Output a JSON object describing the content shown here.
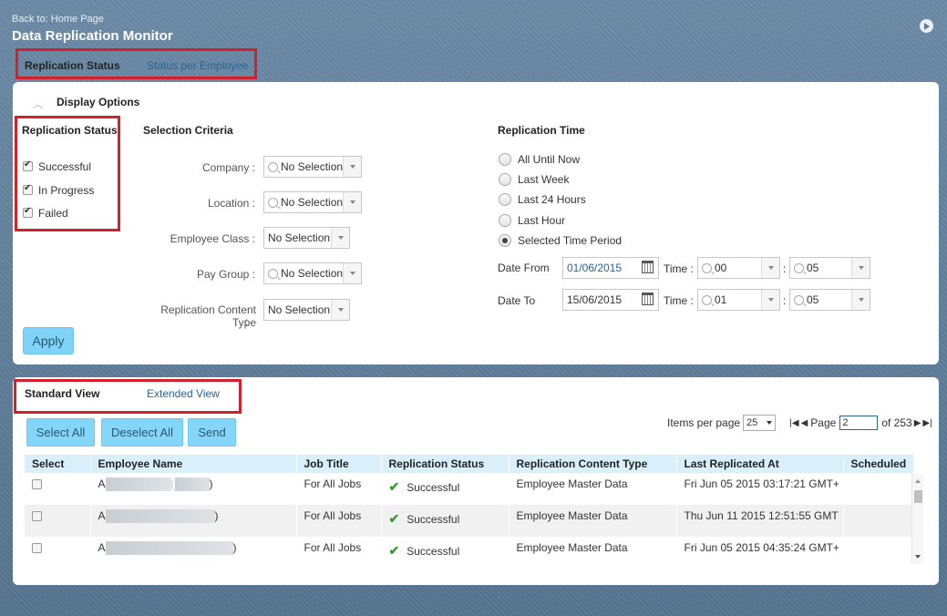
{
  "header": {
    "back_link": "Back to: Home Page",
    "title": "Data Replication Monitor"
  },
  "top_tabs": [
    "Replication Status",
    "Status per Employee"
  ],
  "display_options": {
    "title": "Display Options",
    "replication_status": {
      "title": "Replication Status",
      "options": [
        {
          "label": "Successful",
          "checked": true
        },
        {
          "label": "In Progress",
          "checked": true
        },
        {
          "label": "Failed",
          "checked": true
        }
      ]
    },
    "selection_criteria": {
      "title": "Selection Criteria",
      "fields": [
        {
          "label": "Company :",
          "value": "No Selection"
        },
        {
          "label": "Location :",
          "value": "No Selection"
        },
        {
          "label": "Employee Class :",
          "value": "No Selection"
        },
        {
          "label": "Pay Group :",
          "value": "No Selection"
        },
        {
          "label": "Replication Content Type",
          "label2": ":",
          "value": "No Selection"
        }
      ]
    },
    "replication_time": {
      "title": "Replication Time",
      "options": [
        "All Until Now",
        "Last Week",
        "Last 24 Hours",
        "Last Hour",
        "Selected Time Period"
      ],
      "selected": "Selected Time Period",
      "date_from_label": "Date From",
      "date_from": "01/06/2015",
      "date_to_label": "Date To",
      "date_to": "15/06/2015",
      "time_label": "Time :",
      "from_hour": "00",
      "from_minute": "05",
      "to_hour": "01",
      "to_minute": "05",
      "colon": ":"
    },
    "apply_label": "Apply"
  },
  "view_tabs": [
    "Standard View",
    "Extended View"
  ],
  "toolbar": {
    "select_all": "Select All",
    "deselect_all": "Deselect All",
    "send": "Send"
  },
  "pager": {
    "items_label": "Items per page",
    "items_value": "25",
    "page_label": "Page",
    "page_value": "2",
    "of_label": "of 253"
  },
  "table": {
    "columns": [
      "Select",
      "Employee Name",
      "Job Title",
      "Replication Status",
      "Replication Content Type",
      "Last Replicated At",
      "Scheduled"
    ],
    "rows": [
      {
        "name_prefix": "A",
        "name_suffix": ")",
        "job": "For All Jobs",
        "status": "Successful",
        "content": "Employee Master Data",
        "last": "Fri Jun 05 2015 03:17:21 GMT+",
        "scheduled": ""
      },
      {
        "name_prefix": "A",
        "name_suffix": ")",
        "job": "For All Jobs",
        "status": "Successful",
        "content": "Employee Master Data",
        "last": "Thu Jun 11 2015 12:51:55 GMT",
        "scheduled": ""
      },
      {
        "name_prefix": "A",
        "name_suffix": ")",
        "job": "For All Jobs",
        "status": "Successful",
        "content": "Employee Master Data",
        "last": "Fri Jun 05 2015 04:35:24 GMT+",
        "scheduled": ""
      }
    ]
  },
  "colors": {
    "background": "#5d7d9a",
    "highlight_box": "#d4202a",
    "button": "#84d6f8",
    "success": "#3a9b2f"
  }
}
